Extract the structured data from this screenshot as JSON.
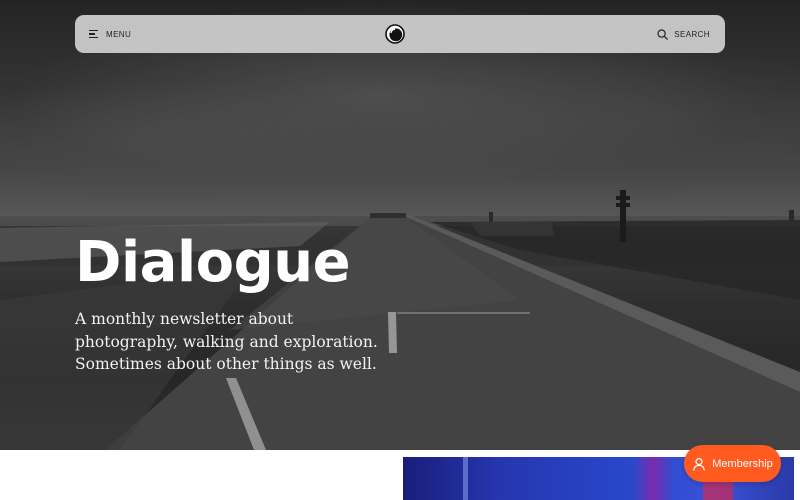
{
  "nav": {
    "menu_label": "MENU",
    "search_label": "SEARCH",
    "icons": {
      "menu": "menu-icon",
      "logo": "site-logo",
      "search": "search-icon"
    }
  },
  "hero": {
    "title": "Dialogue",
    "description": "A monthly newsletter about photography, walking and exploration. Sometimes about other things as well.",
    "image": "black-and-white coastal pier photo"
  },
  "membership": {
    "label": "Membership",
    "icon": "user-icon",
    "color": "#ff5a1f"
  },
  "colors": {
    "navbar": "#d0d0d0",
    "hero_text": "#ffffff",
    "accent": "#ff5a1f"
  }
}
